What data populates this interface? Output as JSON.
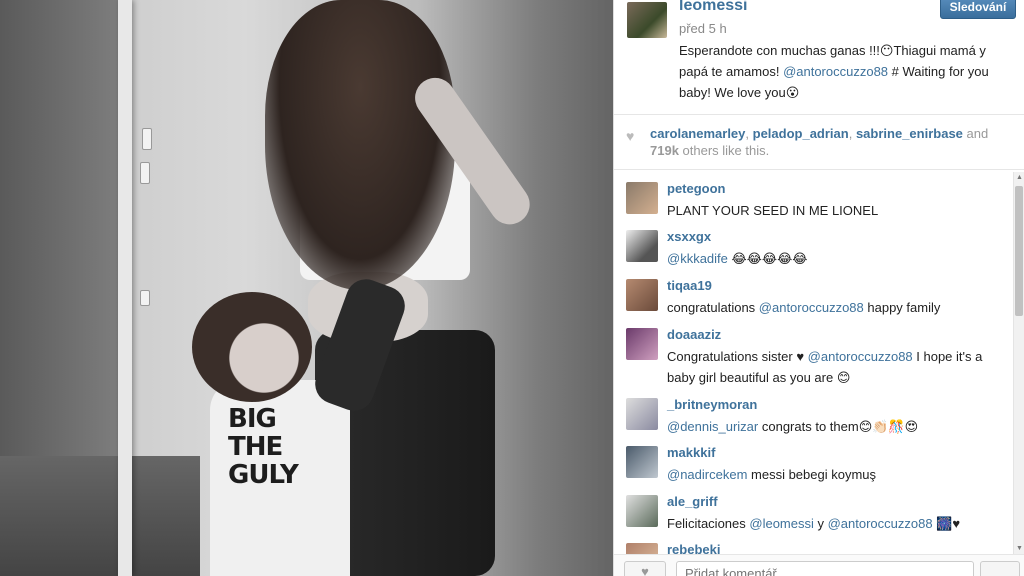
{
  "post": {
    "username": "leomessi",
    "follow_label": "Sledování",
    "time": "před 5 h",
    "caption_parts": {
      "a": "Esperandote con muchas ganas !!!😶Thiagui mamá y papá te amamos! ",
      "mention": "@antoroccuzzo88",
      "b": " # Waiting for you baby! We love you😮"
    },
    "photo_shirt_text": "BIG\nTHE\nGULY"
  },
  "likes": {
    "likers": [
      "carolanemarley",
      "peladop_adrian",
      "sabrine_enirbase"
    ],
    "sep1": ", ",
    "sep2": ", ",
    "and": " and",
    "count": "719k",
    "rest": " others like this."
  },
  "comments": [
    {
      "user": "petegoon",
      "text": "PLANT YOUR SEED IN ME LIONEL",
      "avatar_color": "#8a7a6a"
    },
    {
      "user": "xsxxgx",
      "mention": "@kkkadife",
      "text_after": " 😂😂😂😂😂",
      "avatar_color": "#555555"
    },
    {
      "user": "tiqaa19",
      "text_before": "congratulations ",
      "mention": "@antoroccuzzo88",
      "text_after": " happy family",
      "avatar_color": "#b58a70"
    },
    {
      "user": "doaaaziz",
      "text_before": "Congratulations sister ♥ ",
      "mention": "@antoroccuzzo88",
      "text_after": " I hope it's a baby girl beautiful as you are 😊",
      "avatar_color": "#6a3a6a"
    },
    {
      "user": "_britneymoran",
      "mention": "@dennis_urizar",
      "text_after": " congrats to them😊👏🏻🎊😍",
      "avatar_color": "#8a8aa0"
    },
    {
      "user": "makkkif",
      "mention": "@nadircekem",
      "text_after": " messi bebegi koymuş",
      "avatar_color": "#4a5a6a"
    },
    {
      "user": "ale_griff",
      "text_before": "Felicitaciones ",
      "mention": "@leomessi",
      "text_mid": " y ",
      "mention2": "@antoroccuzzo88",
      "text_after": " 🎆♥",
      "avatar_color": "#5a6a5a"
    },
    {
      "user": "rebebeki",
      "avatar_color": "#b0806a"
    }
  ],
  "footer": {
    "like_icon": "heart-icon",
    "comment_placeholder": "Přidat komentář..."
  },
  "colors": {
    "accent": "#3f729b",
    "follow_button": "#4a7fb0"
  }
}
